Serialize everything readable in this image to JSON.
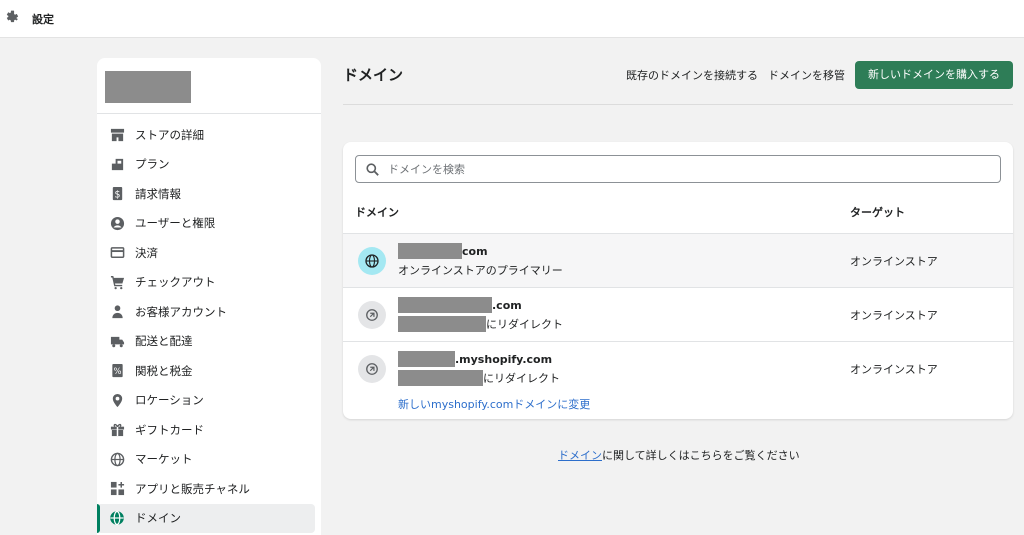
{
  "topbar": {
    "title": "設定",
    "icon": "gear-icon"
  },
  "sidebar": {
    "items": [
      {
        "label": "ストアの詳細",
        "icon": "store-icon"
      },
      {
        "label": "プラン",
        "icon": "plan-icon"
      },
      {
        "label": "請求情報",
        "icon": "billing-icon"
      },
      {
        "label": "ユーザーと権限",
        "icon": "user-circle-icon"
      },
      {
        "label": "決済",
        "icon": "payment-icon"
      },
      {
        "label": "チェックアウト",
        "icon": "cart-icon"
      },
      {
        "label": "お客様アカウント",
        "icon": "person-icon"
      },
      {
        "label": "配送と配達",
        "icon": "truck-icon"
      },
      {
        "label": "関税と税金",
        "icon": "tax-icon"
      },
      {
        "label": "ロケーション",
        "icon": "location-pin-icon"
      },
      {
        "label": "ギフトカード",
        "icon": "gift-icon"
      },
      {
        "label": "マーケット",
        "icon": "globe-icon"
      },
      {
        "label": "アプリと販売チャネル",
        "icon": "apps-icon"
      },
      {
        "label": "ドメイン",
        "icon": "domain-globe-icon",
        "active": true
      }
    ]
  },
  "main": {
    "title": "ドメイン",
    "actions": {
      "connect_label": "既存のドメインを接続する",
      "transfer_label": "ドメインを移管",
      "buy_label": "新しいドメインを購入する"
    },
    "search": {
      "placeholder": "ドメインを検索"
    },
    "table": {
      "col_domain": "ドメイン",
      "col_target": "ターゲット",
      "rows": [
        {
          "name_suffix": "com",
          "sub": "オンラインストアのプライマリー",
          "target": "オンラインストア"
        },
        {
          "name_suffix": ".com",
          "sub_suffix": "にリダイレクト",
          "target": "オンラインストア"
        },
        {
          "name_suffix": ".myshopify.com",
          "sub_suffix": "にリダイレクト",
          "target": "オンラインストア",
          "link": "新しいmyshopify.comドメインに変更"
        }
      ]
    },
    "help": {
      "link": "ドメイン",
      "text": "に関して詳しくはこちらをご覧ください"
    }
  },
  "colors": {
    "primary": "#2e7d57",
    "link": "#2c6ecb",
    "active_indicator": "#008060"
  }
}
